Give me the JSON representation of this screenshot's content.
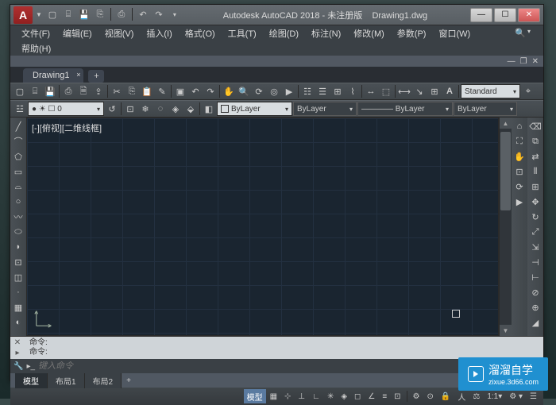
{
  "title": {
    "app": "Autodesk AutoCAD 2018 - 未注册版",
    "doc": "Drawing1.dwg"
  },
  "qat": [
    "new",
    "open",
    "save",
    "save-as",
    "print",
    "undo",
    "redo"
  ],
  "menu": [
    "文件(F)",
    "编辑(E)",
    "视图(V)",
    "插入(I)",
    "格式(O)",
    "工具(T)",
    "绘图(D)",
    "标注(N)",
    "修改(M)",
    "参数(P)",
    "窗口(W)"
  ],
  "menu2": "帮助(H)",
  "filetab": {
    "name": "Drawing1",
    "add": "+"
  },
  "layers": {
    "left_label": "● ☀ ☐ 0",
    "combos": [
      "ByLayer",
      "ByLayer",
      "———— ByLayer",
      "ByLayer"
    ],
    "standard": "Standard"
  },
  "view_label": "[-][俯视][二维线框]",
  "cmd": {
    "hist1": "命令:",
    "hist2": "命令:",
    "placeholder": "键入命令"
  },
  "layout_tabs": {
    "model": "模型",
    "l1": "布局1",
    "l2": "布局2",
    "add": "+"
  },
  "status": {
    "left": "模型",
    "scale": "1:1",
    "zoom_icons": [
      "grid",
      "snap",
      "ortho",
      "polar",
      "osnap",
      "3dosnap",
      "otrack",
      "dyn",
      "lwt",
      "tpy",
      "qp",
      "sc"
    ]
  },
  "watermark": {
    "main": "溜溜自学",
    "sub": "zixue.3d66.com"
  }
}
